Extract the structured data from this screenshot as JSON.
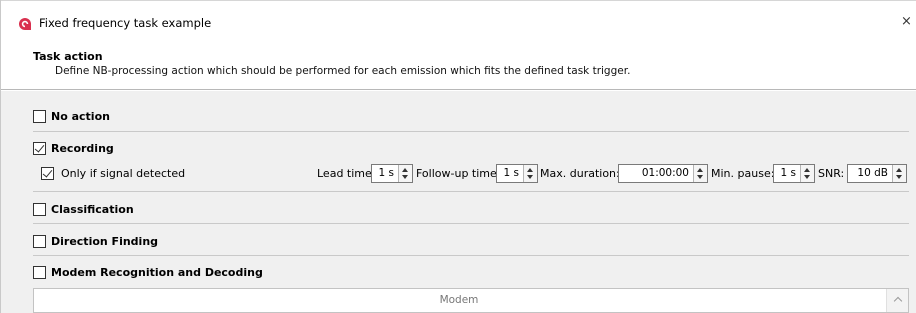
{
  "window": {
    "title": "Fixed frequency task example",
    "close_symbol": "×",
    "icon": "app-logo-icon",
    "accent_color": "#d9304f"
  },
  "header": {
    "title": "Task action",
    "description": "Define NB-processing action which should be performed for each emission which fits the defined task trigger."
  },
  "sections": {
    "no_action": {
      "label": "No action",
      "checked": false
    },
    "recording": {
      "label": "Recording",
      "checked": true,
      "only_if_signal": {
        "label": "Only if signal detected",
        "checked": true
      },
      "lead_time": {
        "label": "Lead time:",
        "value": "1 s"
      },
      "follow_up_time": {
        "label": "Follow-up time:",
        "value": "1 s"
      },
      "max_duration": {
        "label": "Max. duration:",
        "value": "01:00:00"
      },
      "min_pause": {
        "label": "Min. pause:",
        "value": "1 s"
      },
      "snr": {
        "label": "SNR:",
        "value": "10 dB"
      }
    },
    "classification": {
      "label": "Classification",
      "checked": false
    },
    "direction_finding": {
      "label": "Direction Finding",
      "checked": false
    },
    "modem": {
      "label": "Modem Recognition and Decoding",
      "checked": false,
      "table_header": "Modem"
    }
  }
}
